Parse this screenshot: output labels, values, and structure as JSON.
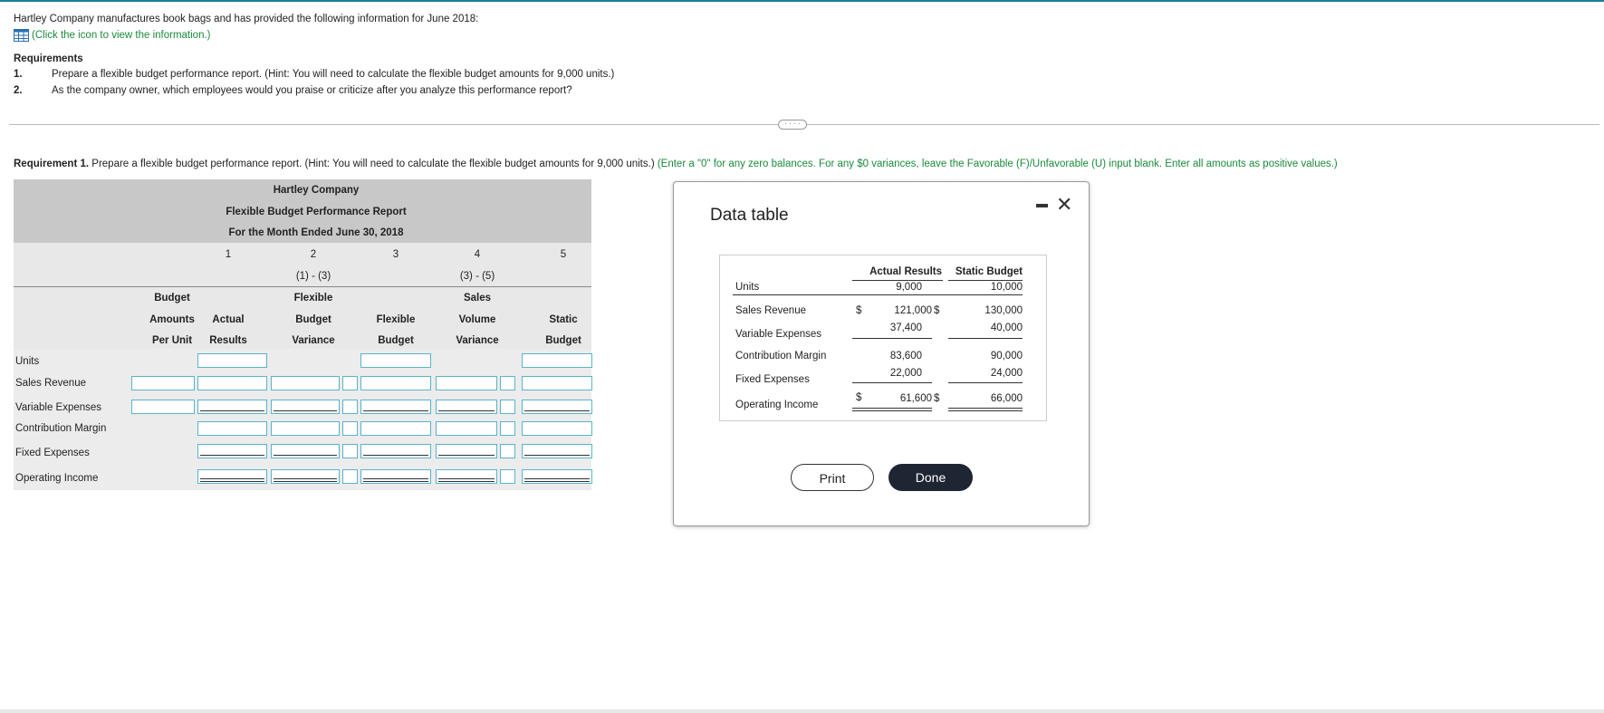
{
  "intro": {
    "text": "Hartley Company manufactures book bags and has provided the following information for June 2018:",
    "link": "(Click the icon to view the information.)"
  },
  "requirements": {
    "title": "Requirements",
    "items": [
      {
        "num": "1.",
        "text": "Prepare a flexible budget performance report. (Hint: You will need to calculate the flexible budget amounts for 9,000 units.)"
      },
      {
        "num": "2.",
        "text": "As the company owner, which employees would you praise or criticize after you analyze this performance report?"
      }
    ]
  },
  "req1": {
    "label": "Requirement 1.",
    "text": " Prepare a flexible budget performance report. (Hint: You will need to calculate the flexible budget amounts for 9,000 units.) ",
    "instructions": "(Enter a \"0\" for any zero balances. For any $0 variances, leave the Favorable (F)/Unfavorable (U) input blank. Enter all amounts as positive values.)"
  },
  "report": {
    "company": "Hartley Company",
    "title": "Flexible Budget Performance Report",
    "period": "For the Month Ended June 30, 2018",
    "col_numbers": [
      "1",
      "2",
      "3",
      "4",
      "5"
    ],
    "formulas": {
      "c2": "(1) - (3)",
      "c4": "(3) - (5)"
    },
    "headers": {
      "budget_per_unit": [
        "Budget",
        "Amounts",
        "Per Unit"
      ],
      "actual": [
        "Actual",
        "Results"
      ],
      "flex_var": [
        "Flexible",
        "Budget",
        "Variance"
      ],
      "flex_budget": [
        "Flexible",
        "Budget"
      ],
      "sales_vol": [
        "Sales",
        "Volume",
        "Variance"
      ],
      "static": [
        "Static",
        "Budget"
      ]
    },
    "rows": [
      "Units",
      "Sales Revenue",
      "Variable Expenses",
      "Contribution Margin",
      "Fixed Expenses",
      "Operating Income"
    ]
  },
  "modal": {
    "title": "Data table",
    "columns": [
      "Actual Results",
      "Static Budget"
    ],
    "rows": [
      {
        "label": "Units",
        "sign_a": "",
        "actual": "9,000",
        "sign_s": "",
        "static": "10,000"
      },
      {
        "label": "Sales Revenue",
        "sign_a": "$",
        "actual": "121,000",
        "sign_s": "$",
        "static": "130,000"
      },
      {
        "label": "Variable Expenses",
        "sign_a": "",
        "actual": "37,400",
        "sign_s": "",
        "static": "40,000"
      },
      {
        "label": "Contribution Margin",
        "sign_a": "",
        "actual": "83,600",
        "sign_s": "",
        "static": "90,000"
      },
      {
        "label": "Fixed Expenses",
        "sign_a": "",
        "actual": "22,000",
        "sign_s": "",
        "static": "24,000"
      },
      {
        "label": "Operating Income",
        "sign_a": "$",
        "actual": "61,600",
        "sign_s": "$",
        "static": "66,000"
      }
    ],
    "print_label": "Print",
    "done_label": "Done",
    "close_glyph": "✕"
  },
  "colors": {
    "accent": "#1a7f96",
    "link_green": "#1a8a3a",
    "input_border": "#5ab4c9",
    "done_bg": "#1f2633"
  }
}
